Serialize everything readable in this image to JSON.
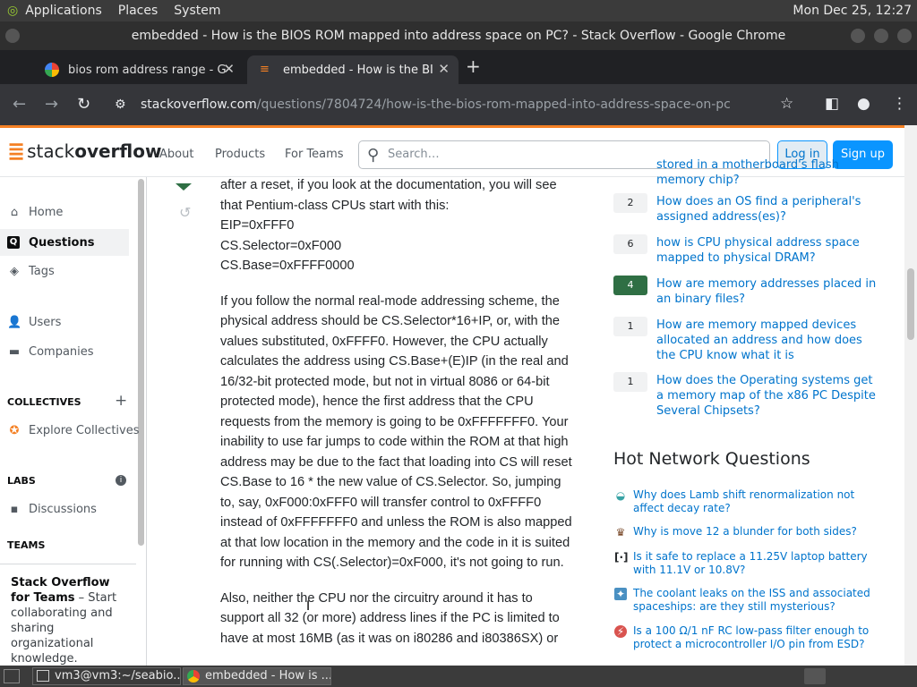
{
  "system_bar": {
    "menus": [
      "Applications",
      "Places",
      "System"
    ],
    "clock": "Mon Dec 25, 12:27"
  },
  "window": {
    "title": "embedded - How is the BIOS ROM mapped into address space on PC? - Stack Overflow - Google Chrome"
  },
  "browser": {
    "tabs": [
      {
        "label": "bios rom address range - Go",
        "active": false
      },
      {
        "label": "embedded - How is the BIOS",
        "active": true
      }
    ],
    "url_host": "stackoverflow.com",
    "url_path": "/questions/7804724/how-is-the-bios-rom-mapped-into-address-space-on-pc"
  },
  "so_header": {
    "logo_light": "stack",
    "logo_bold": "overflow",
    "nav": [
      "About",
      "Products",
      "For Teams"
    ],
    "search_placeholder": "Search…",
    "login": "Log in",
    "signup": "Sign up"
  },
  "left_nav": {
    "home": "Home",
    "questions": "Questions",
    "tags": "Tags",
    "users": "Users",
    "companies": "Companies",
    "collectives_heading": "COLLECTIVES",
    "explore_collectives": "Explore Collectives",
    "labs_heading": "LABS",
    "discussions": "Discussions",
    "teams_heading": "TEAMS",
    "teams_promo_title": "Stack Overflow for Teams",
    "teams_promo_text": " – Start collaborating and sharing organizational knowledge."
  },
  "post": {
    "paragraphs": [
      "after a reset, if you look at the documentation, you will see that Pentium-class CPUs start with this:\nEIP=0xFFF0\nCS.Selector=0xF000\nCS.Base=0xFFFF0000",
      "If you follow the normal real-mode addressing scheme, the physical address should be CS.Selector*16+IP, or, with the values substituted, 0xFFFF0. However, the CPU actually calculates the address using CS.Base+(E)IP (in the real and 16/32-bit protected mode, but not in virtual 8086 or 64-bit protected mode), hence the first address that the CPU requests from the memory is going to be 0xFFFFFFF0. Your inability to use far jumps to code within the ROM at that high address may be due to the fact that loading into CS will reset CS.Base to 16 * the new value of CS.Selector. So, jumping to, say, 0xF000:0xFFF0 will transfer control to 0xFFFF0 instead of 0xFFFFFFF0 and unless the ROM is also mapped at that low location in the memory and the code in it is suited for running with CS(.Selector)=0xF000, it's not going to run.",
      "Also, neither the CPU nor the circuitry around it has to support all 32 (or more) address lines if the PC is limited to have at most 16MB (as it was on i80286 and i80386SX) or"
    ]
  },
  "related": [
    {
      "count": "",
      "title": "stored in a motherboard's flash memory chip?",
      "accepted": false
    },
    {
      "count": "2",
      "title": "How does an OS find a peripheral's assigned address(es)?",
      "accepted": false
    },
    {
      "count": "6",
      "title": "how is CPU physical address space mapped to physical DRAM?",
      "accepted": false
    },
    {
      "count": "4",
      "title": "How are memory addresses placed in an binary files?",
      "accepted": true
    },
    {
      "count": "1",
      "title": "How are memory mapped devices allocated an address and how does the CPU know what it is",
      "accepted": false
    },
    {
      "count": "1",
      "title": "How does the Operating systems get a memory map of the x86 PC Despite Several Chipsets?",
      "accepted": false
    }
  ],
  "hnq": {
    "heading": "Hot Network Questions",
    "items": [
      {
        "site_icon": "physics-icon",
        "title": "Why does Lamb shift renormalization not affect decay rate?"
      },
      {
        "site_icon": "chess-icon",
        "title": "Why is move 12 a blunder for both sides?"
      },
      {
        "site_icon": "electronics-icon",
        "title": "Is it safe to replace a 11.25V laptop battery with 11.1V or 10.8V?"
      },
      {
        "site_icon": "space-icon",
        "title": "The coolant leaks on the ISS and associated spaceships: are they still mysterious?"
      },
      {
        "site_icon": "electrical-icon",
        "title": "Is a 100 Ω/1 nF RC low-pass filter enough to protect a microcontroller I/O pin from ESD?"
      }
    ]
  },
  "taskbar": {
    "items": [
      "vm3@vm3:~/seabio...",
      "embedded - How is ..."
    ]
  },
  "colors": {
    "so_orange": "#f48024",
    "so_blue": "#0a95ff",
    "link": "#0074cc",
    "accepted_green": "#2f6f44"
  }
}
